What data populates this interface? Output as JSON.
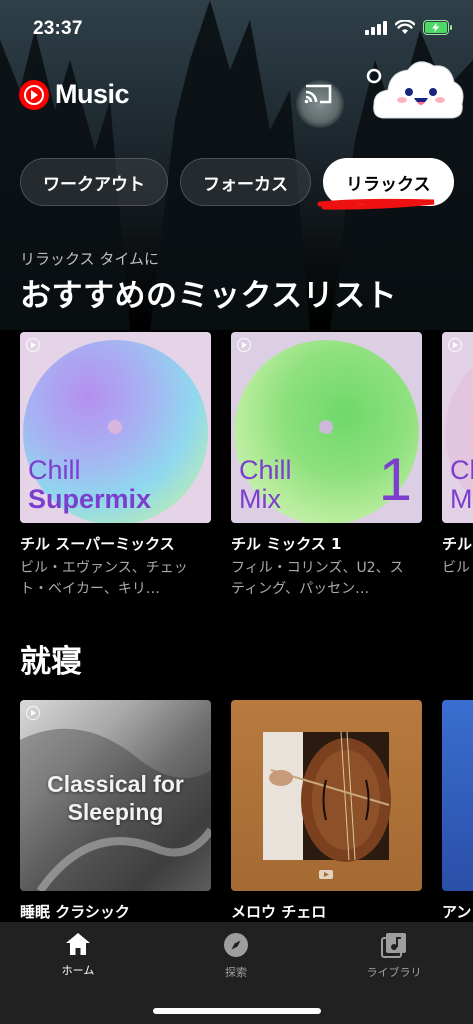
{
  "status_bar": {
    "time": "23:37",
    "icons": [
      "signal-icon",
      "wifi-icon",
      "battery-charging-icon"
    ]
  },
  "header": {
    "logo_text": "Music",
    "cast_icon": "cast-icon",
    "avatar_icon": "cloud-avatar-icon"
  },
  "chips": [
    {
      "label": "ワークアウト",
      "selected": false
    },
    {
      "label": "フォーカス",
      "selected": false
    },
    {
      "label": "リラックス",
      "selected": true
    }
  ],
  "section1": {
    "subtitle": "リラックス タイムに",
    "title": "おすすめのミックスリスト",
    "cards": [
      {
        "art_line1": "Chill",
        "art_line2": "Supermix",
        "title": "チル スーパーミックス",
        "subtitle": "ビル・エヴァンス、チェット・ベイカー、キリ…"
      },
      {
        "art_line1": "Chill",
        "art_line2": "Mix",
        "art_number": "1",
        "title": "チル ミックス 1",
        "subtitle": "フィル・コリンズ、U2、スティング、パッセン…"
      },
      {
        "art_line1": "Ch",
        "art_line2": "M",
        "title": "チル",
        "subtitle": "ビル シカ"
      }
    ]
  },
  "section2": {
    "title": "就寝",
    "cards": [
      {
        "art_text_1": "Classical for",
        "art_text_2": "Sleeping",
        "title": "睡眠 クラシック"
      },
      {
        "title": "メロウ チェロ"
      },
      {
        "title": "アン"
      }
    ]
  },
  "nav": [
    {
      "label": "ホーム",
      "icon": "home-icon",
      "active": true
    },
    {
      "label": "探索",
      "icon": "compass-icon",
      "active": false
    },
    {
      "label": "ライブラリ",
      "icon": "library-icon",
      "active": false
    }
  ],
  "colors": {
    "accent_red": "#ff0000",
    "mix_purple": "#7c3ecf",
    "nav_bg": "#212121"
  }
}
